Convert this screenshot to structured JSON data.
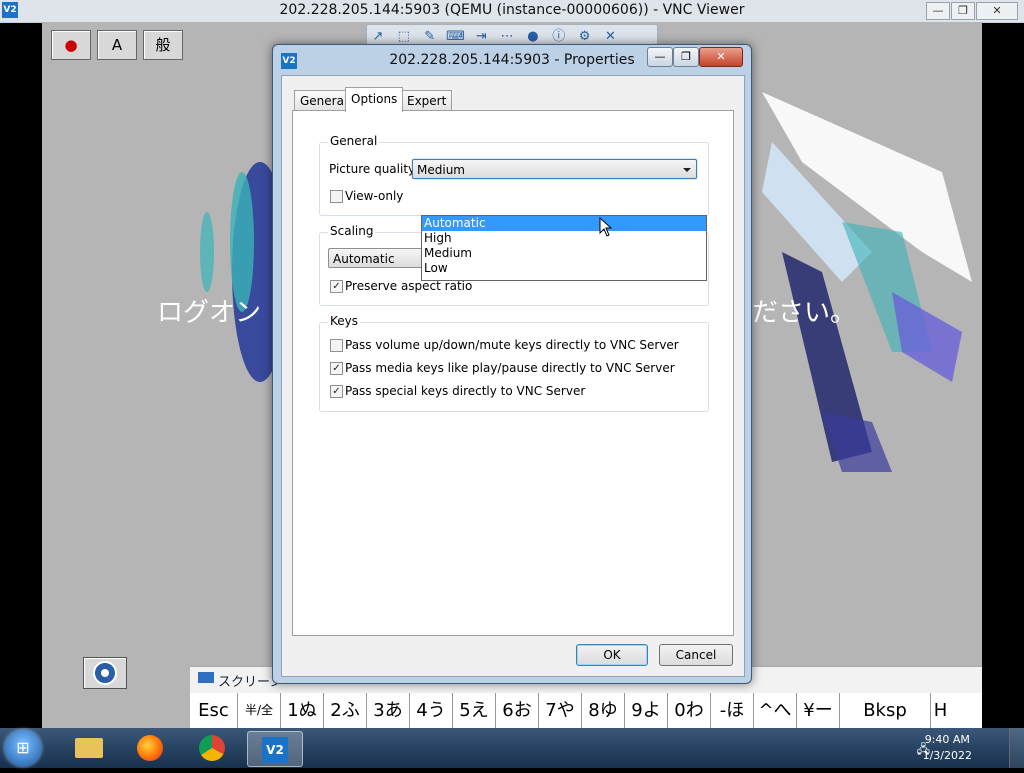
{
  "window": {
    "title": "202.228.205.144:5903 (QEMU (instance-00000606)) - VNC Viewer",
    "app_icon": "V2",
    "minimize_glyph": "—",
    "maximize_glyph": "❐",
    "close_glyph": "✕"
  },
  "remote": {
    "ime_buttons": [
      "",
      "A",
      "般"
    ],
    "logon_left": "ログオン",
    "logon_right": "ださい。"
  },
  "vnc_toolbar": {
    "icons": [
      "↗",
      "⬚",
      "✎",
      "⌨",
      "⇥",
      "⋯",
      "●",
      "ⓘ",
      "⚙",
      "✕"
    ]
  },
  "osk": {
    "title": "スクリーン",
    "keys": [
      "Esc",
      "半/全",
      "1ぬ",
      "2ふ",
      "3あ",
      "4う",
      "5え",
      "6お",
      "7や",
      "8ゆ",
      "9よ",
      "0わ",
      "-ほ",
      "^へ",
      "¥ー",
      "Bksp",
      "H"
    ]
  },
  "dialog": {
    "title": "202.228.205.144:5903 - Properties",
    "icon": "V2",
    "tabs": [
      "General",
      "Options",
      "Expert"
    ],
    "selected_tab": "Options",
    "general_group": {
      "label": "General",
      "picture_quality_label": "Picture quality:",
      "picture_quality_value": "Medium",
      "view_only_label": "View-only",
      "view_only_checked": false,
      "dropdown_options": [
        "Automatic",
        "High",
        "Medium",
        "Low"
      ],
      "highlighted_option": "Automatic"
    },
    "scaling_group": {
      "label": "Scaling",
      "value": "Automatic",
      "preserve_label": "Preserve aspect ratio",
      "preserve_checked": true
    },
    "keys_group": {
      "label": "Keys",
      "items": [
        {
          "label": "Pass volume up/down/mute keys directly to VNC Server",
          "checked": false
        },
        {
          "label": "Pass media keys like play/pause directly to VNC Server",
          "checked": true
        },
        {
          "label": "Pass special keys directly to VNC Server",
          "checked": true
        }
      ]
    },
    "ok_label": "OK",
    "cancel_label": "Cancel"
  },
  "taskbar": {
    "clock_time": "9:40 AM",
    "clock_date": "1/3/2022",
    "apps": [
      "explorer",
      "firefox",
      "chrome",
      "vnc-viewer"
    ]
  }
}
